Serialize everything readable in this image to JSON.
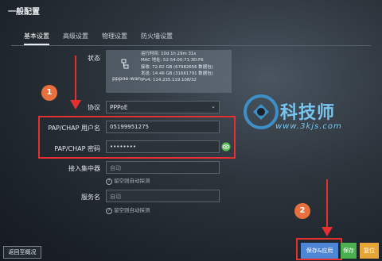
{
  "page": {
    "title": "一般配置"
  },
  "tabs": [
    {
      "label": "基本设置",
      "active": true
    },
    {
      "label": "高级设置",
      "active": false
    },
    {
      "label": "物理设置",
      "active": false
    },
    {
      "label": "防火墙设置",
      "active": false
    }
  ],
  "status": {
    "label": "状态",
    "name": "pppoe-wan",
    "lines": [
      "运行时间: 10d 1h 29m 31s",
      "MAC 地址: 52:54:00:71:3D:F6",
      "接收: 72.82 GB (67982656 数据包)",
      "发送: 14.46 GB (31661791 数据包)",
      "IPv4: 114.235.119.108/32"
    ]
  },
  "protocol": {
    "label": "协议",
    "value": "PPPoE"
  },
  "username": {
    "label": "PAP/CHAP 用户名",
    "value": "05199951275"
  },
  "password": {
    "label": "PAP/CHAP 密码",
    "value": "••••••••"
  },
  "concentrator": {
    "label": "接入集中器",
    "placeholder": "自动",
    "hint": "留空则自动探测"
  },
  "service": {
    "label": "服务名",
    "placeholder": "自动",
    "hint": "留空则自动探测"
  },
  "annotations": {
    "badge1": "1",
    "badge2": "2"
  },
  "watermark": {
    "title": "科技师",
    "url": "www.3kjs.com"
  },
  "buttons": {
    "back": "返回至概况",
    "save_apply": "保存&应用",
    "save": "保存",
    "reset": "复位"
  }
}
